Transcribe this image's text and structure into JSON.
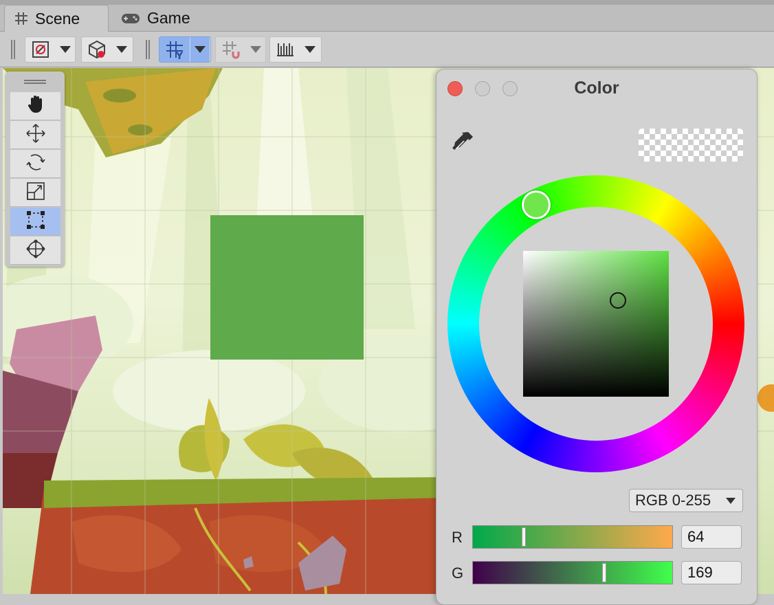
{
  "tabs": [
    {
      "label": "Scene",
      "icon": "grid-hash-icon",
      "active": true
    },
    {
      "label": "Game",
      "icon": "gamepad-icon",
      "active": false
    }
  ],
  "toolbar": {
    "items": [
      "draw-mode",
      "shading-mode",
      "grid-snap",
      "increment-snap",
      "ruler-snap"
    ],
    "selected": "grid-snap"
  },
  "tool_palette": {
    "tools": [
      "hand",
      "move",
      "rotate",
      "scale",
      "rect",
      "transform"
    ],
    "selected": "rect"
  },
  "scene": {
    "selected_object_color": "#5faa4b"
  },
  "color_window": {
    "title": "Color",
    "mode": "RGB 0-255",
    "channels": [
      {
        "label": "R",
        "value": "64",
        "fraction": 0.251
      },
      {
        "label": "G",
        "value": "169",
        "fraction": 0.663
      }
    ],
    "hue_knob_color": "#6fe64c",
    "accent_close": "#ee5e57"
  }
}
